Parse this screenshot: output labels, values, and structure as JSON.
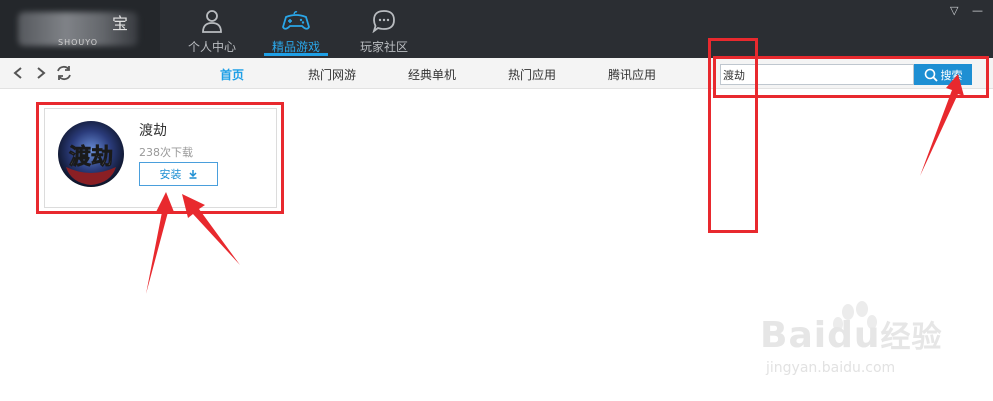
{
  "titlebar": {
    "logo_sub": "SHOUYO",
    "logo_char": "宝",
    "tabs": [
      {
        "label": "个人中心",
        "icon": "person-icon"
      },
      {
        "label": "精品游戏",
        "icon": "gamepad-icon",
        "active": true
      },
      {
        "label": "玩家社区",
        "icon": "chat-bubble-icon"
      }
    ],
    "window_controls": {
      "menu": "▽",
      "minimize": "—"
    }
  },
  "toolbar": {
    "back": "<",
    "forward": ">",
    "categories": [
      {
        "label": "首页",
        "active": true
      },
      {
        "label": "热门网游"
      },
      {
        "label": "经典单机"
      },
      {
        "label": "热门应用"
      },
      {
        "label": "腾讯应用"
      }
    ],
    "search": {
      "value": "渡劫",
      "button_label": "搜索"
    }
  },
  "result": {
    "icon_text": "渡劫",
    "title": "渡劫",
    "downloads": "238次下载",
    "install_label": "安装"
  },
  "watermark": {
    "brand": "Bai",
    "suffix": "du",
    "cn": "经验",
    "url": "jingyan.baidu.com"
  },
  "colors": {
    "accent": "#1e9fe6",
    "annotation": "#e8292e",
    "titlebar": "#2b2e33"
  }
}
